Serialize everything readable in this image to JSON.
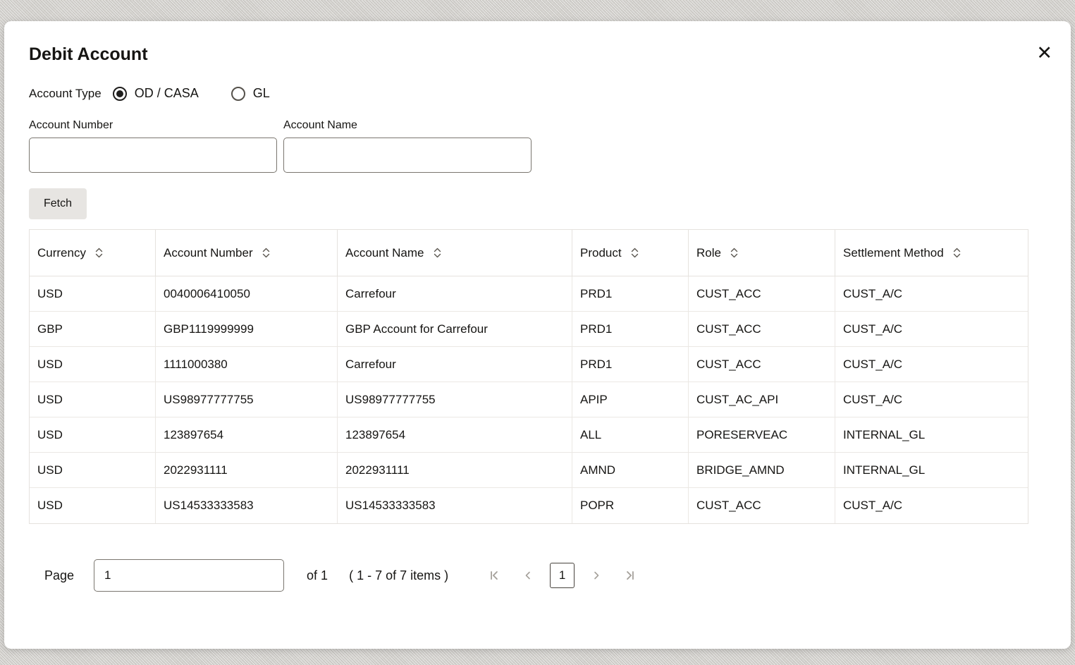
{
  "modal": {
    "title": "Debit Account"
  },
  "icons": {
    "close": "✕"
  },
  "form": {
    "account_type_label": "Account Type",
    "radio_options": [
      {
        "label": "OD / CASA",
        "selected": true
      },
      {
        "label": "GL",
        "selected": false
      }
    ],
    "account_number_label": "Account Number",
    "account_number_value": "",
    "account_name_label": "Account Name",
    "account_name_value": "",
    "fetch_button_label": "Fetch"
  },
  "table": {
    "columns": [
      "Currency",
      "Account Number",
      "Account Name",
      "Product",
      "Role",
      "Settlement Method"
    ],
    "rows": [
      [
        "USD",
        "0040006410050",
        "Carrefour",
        "PRD1",
        "CUST_ACC",
        "CUST_A/C"
      ],
      [
        "GBP",
        "GBP1119999999",
        "GBP Account for Carrefour",
        "PRD1",
        "CUST_ACC",
        "CUST_A/C"
      ],
      [
        "USD",
        "1111000380",
        "Carrefour",
        "PRD1",
        "CUST_ACC",
        "CUST_A/C"
      ],
      [
        "USD",
        "US98977777755",
        "US98977777755",
        "APIP",
        "CUST_AC_API",
        "CUST_A/C"
      ],
      [
        "USD",
        "123897654",
        "123897654",
        "ALL",
        "PORESERVEAC",
        "INTERNAL_GL"
      ],
      [
        "USD",
        "2022931111",
        "2022931111",
        "AMND",
        "BRIDGE_AMND",
        "INTERNAL_GL"
      ],
      [
        "USD",
        "US14533333583",
        "US14533333583",
        "POPR",
        "CUST_ACC",
        "CUST_A/C"
      ]
    ]
  },
  "pagination": {
    "page_label": "Page",
    "page_input_value": "1",
    "of_label": "of 1",
    "items_label": "( 1 - 7 of 7 items )",
    "current_page": "1"
  }
}
